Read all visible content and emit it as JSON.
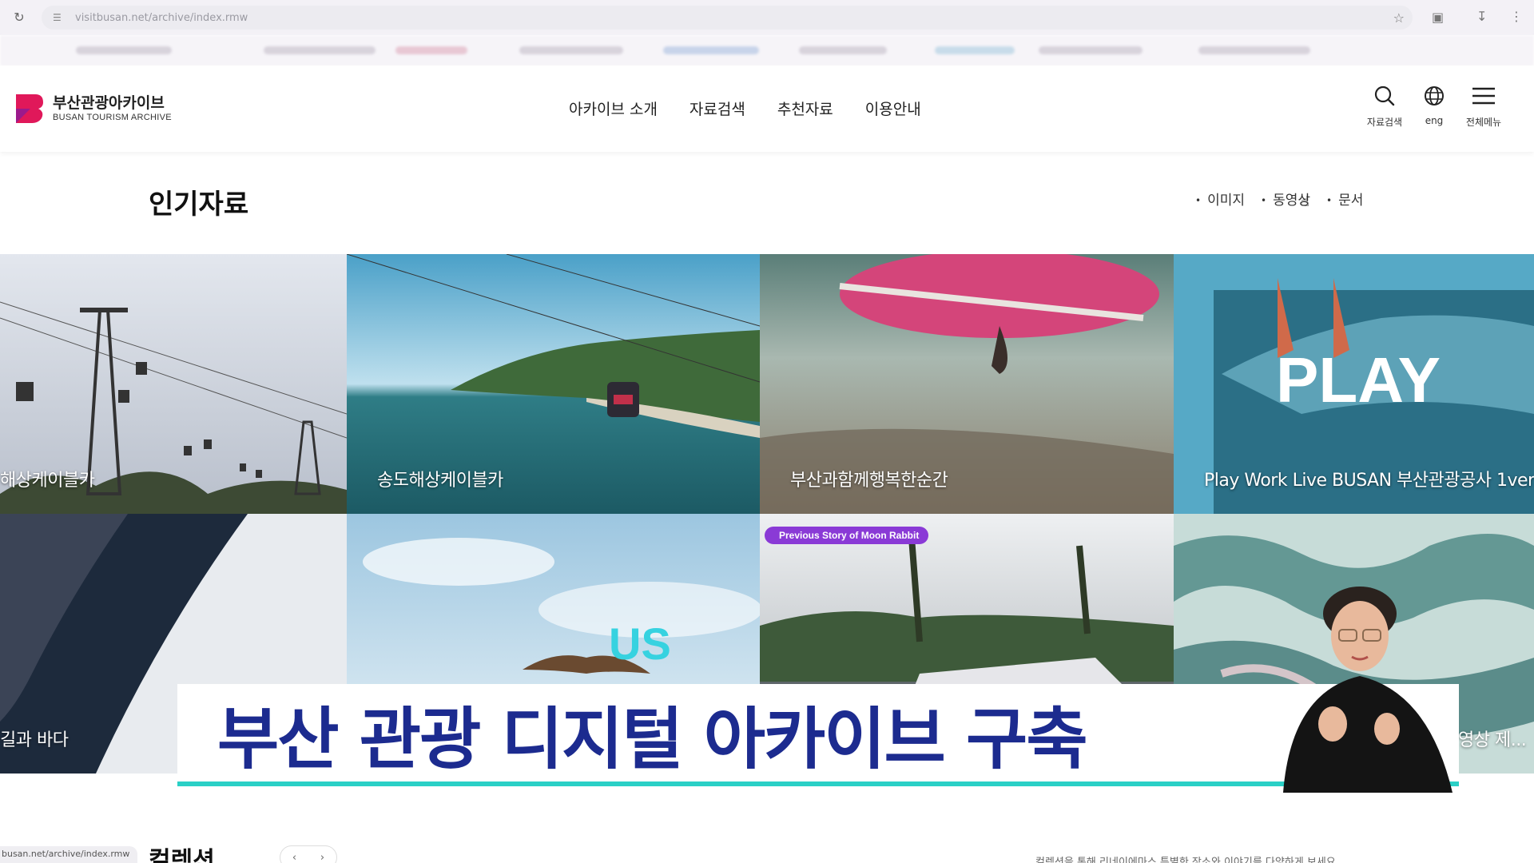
{
  "browser": {
    "url": "visitbusan.net/archive/index.rmw",
    "icons": [
      "reload-icon",
      "site-info-icon",
      "star-icon",
      "extensions-icon",
      "download-icon",
      "menu-icon"
    ]
  },
  "header": {
    "logo_title": "부산관광아카이브",
    "logo_sub": "BUSAN TOURISM ARCHIVE",
    "nav": [
      "아카이브 소개",
      "자료검색",
      "추천자료",
      "이용안내"
    ],
    "utils": [
      {
        "icon": "search-icon",
        "label": "자료검색"
      },
      {
        "icon": "globe-icon",
        "label": "eng"
      },
      {
        "icon": "hamburger-icon",
        "label": "전체메뉴"
      }
    ]
  },
  "popular": {
    "title": "인기자료",
    "filters": [
      "이미지",
      "동영상",
      "문서"
    ]
  },
  "tiles": [
    {
      "caption": "해상케이블카"
    },
    {
      "caption": "송도해상케이블카"
    },
    {
      "caption": "부산과함께행복한순간"
    },
    {
      "caption": "Play Work Live BUSAN 부산관광공사 1ver",
      "overlay": "PLAY"
    },
    {
      "caption": "길과 바다"
    },
    {
      "caption": "",
      "overlay": "US"
    },
    {
      "caption": "",
      "badge": "Previous Story of Moon Rabbit"
    },
    {
      "caption": "영상 제..."
    }
  ],
  "collection": {
    "title": "컬렉션",
    "description": "컬렉션을 통해 리네이에마스 특별한 장소와 이야기를 다양하게 보세요",
    "status_url": "busan.net/archive/index.rmw"
  },
  "broadcast": {
    "caption": "부산 관광 디지털 아카이브 구축"
  },
  "colors": {
    "brand": "#e0185a",
    "caption_text": "#1c2b8f",
    "caption_line": "#2ad0c6"
  }
}
